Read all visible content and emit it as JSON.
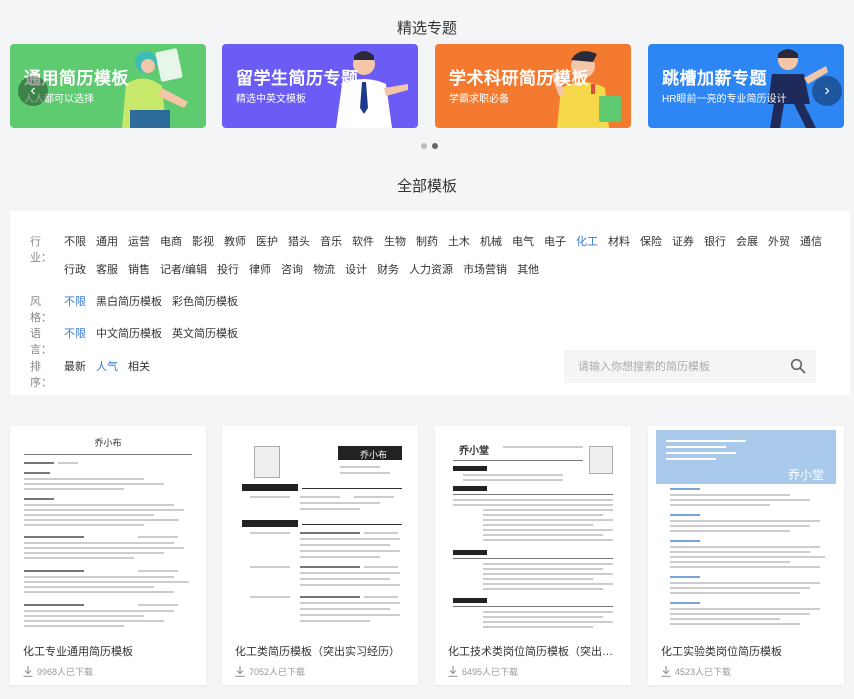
{
  "featured": {
    "title": "精选专题",
    "banners": [
      {
        "title": "通用简历模板",
        "subtitle": "人人都可以选择",
        "color": "#5fcb71"
      },
      {
        "title": "留学生简历专题",
        "subtitle": "精选中英文模板",
        "color": "#6b5cf6"
      },
      {
        "title": "学术科研简历模板",
        "subtitle": "学霸求职必备",
        "color": "#f47a30"
      },
      {
        "title": "跳槽加薪专题",
        "subtitle": "HR眼前一亮的专业简历设计",
        "color": "#2e86f5"
      }
    ],
    "prev_symbol": "‹",
    "next_symbol": "›"
  },
  "all_templates": {
    "title": "全部模板",
    "industry": {
      "label": "行业：",
      "items": [
        "不限",
        "通用",
        "运营",
        "电商",
        "影视",
        "教师",
        "医护",
        "猎头",
        "音乐",
        "软件",
        "生物",
        "制药",
        "土木",
        "机械",
        "电气",
        "电子",
        "化工",
        "材料",
        "保险",
        "证券",
        "银行",
        "会展",
        "外贸",
        "通信",
        "行政",
        "客服",
        "销售",
        "记者/编辑",
        "投行",
        "律师",
        "咨询",
        "物流",
        "设计",
        "财务",
        "人力资源",
        "市场营销",
        "其他"
      ],
      "selected": "化工"
    },
    "style": {
      "label": "风格：",
      "items": [
        "不限",
        "黑白简历模板",
        "彩色简历模板"
      ],
      "selected": "不限"
    },
    "language": {
      "label": "语言：",
      "items": [
        "不限",
        "中文简历模板",
        "英文简历模板"
      ],
      "selected": "不限"
    },
    "sort": {
      "label": "排序：",
      "items": [
        "最新",
        "人气",
        "相关"
      ],
      "selected": "人气"
    },
    "search": {
      "placeholder": "请输入你想搜索的简历模板"
    }
  },
  "cards": [
    {
      "title": "化工专业通用简历模板",
      "downloads": "9968人已下载",
      "name": "乔小布"
    },
    {
      "title": "化工类简历模板（突出实习经历）",
      "downloads": "7052人已下载",
      "name": "乔小布"
    },
    {
      "title": "化工技术类岗位简历模板（突出学术经历）",
      "downloads": "6495人已下载",
      "name": "乔小堂"
    },
    {
      "title": "化工实验类岗位简历模板",
      "downloads": "4523人已下载",
      "name": "乔小堂"
    }
  ],
  "colors": {
    "accent": "#3a7bd5"
  },
  "icons": {
    "search": "search-icon",
    "download": "download-icon"
  }
}
